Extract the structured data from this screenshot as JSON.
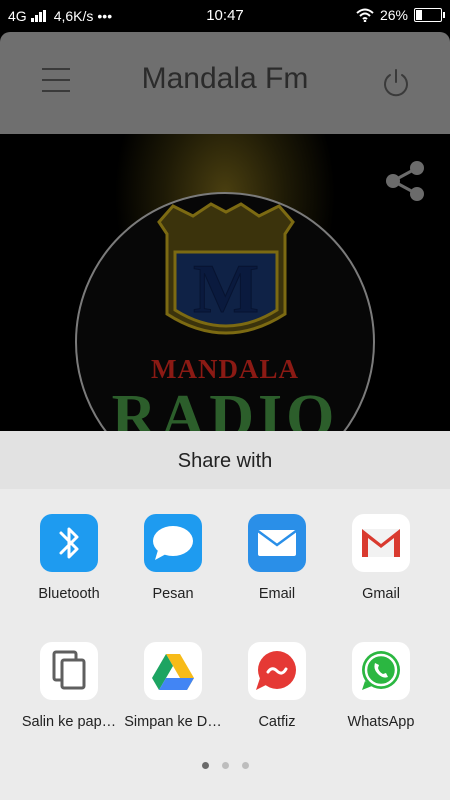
{
  "status_bar": {
    "network": "4G",
    "speed": "4,6K/s",
    "more": "•••",
    "time": "10:47",
    "battery": "26%"
  },
  "app": {
    "title": "Mandala Fm",
    "menu_icon": "hamburger-menu-icon",
    "power_icon": "power-icon",
    "share_icon": "share-icon"
  },
  "logo": {
    "monogram": "M",
    "brand": "MANDALA",
    "subtitle": "RADIO"
  },
  "share_sheet": {
    "title": "Share with",
    "apps": [
      {
        "label": "Bluetooth",
        "icon": "bluetooth-icon",
        "color": "#1e9bf0"
      },
      {
        "label": "Pesan",
        "icon": "messages-icon",
        "color": "#1e9bf0"
      },
      {
        "label": "Email",
        "icon": "email-icon",
        "color": "#2a8fe8"
      },
      {
        "label": "Gmail",
        "icon": "gmail-icon",
        "color": "#d93a2f"
      },
      {
        "label": "Salin ke pap…",
        "icon": "copy-icon",
        "color": "#5f5f5f"
      },
      {
        "label": "Simpan ke D…",
        "icon": "google-drive-icon",
        "color": "#1da462"
      },
      {
        "label": "Catfiz",
        "icon": "catfiz-icon",
        "color": "#e53935"
      },
      {
        "label": "WhatsApp",
        "icon": "whatsapp-icon",
        "color": "#2bb741"
      }
    ],
    "pages": 3,
    "current_page": 1
  }
}
